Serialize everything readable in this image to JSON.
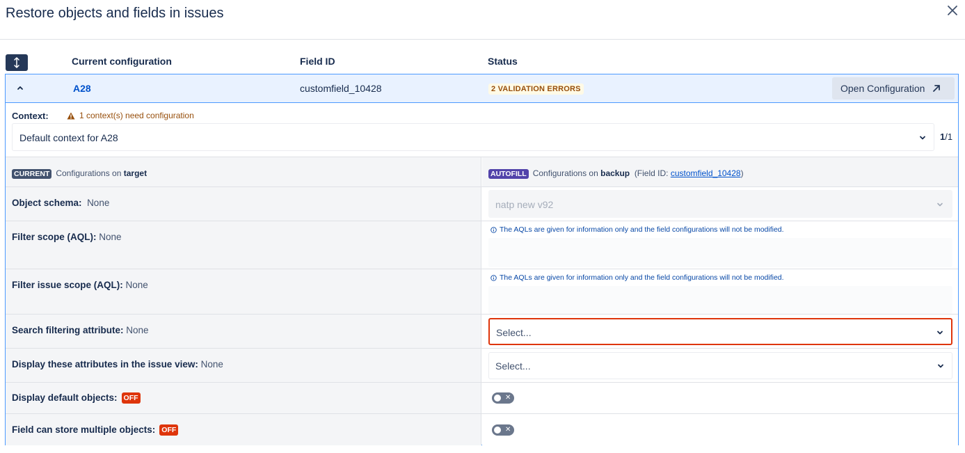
{
  "dialog": {
    "title": "Restore objects and fields in issues"
  },
  "table": {
    "col_current": "Current configuration",
    "col_field_id": "Field ID",
    "col_status": "Status"
  },
  "row": {
    "name": "A28",
    "field_id": "customfield_10428",
    "status": "2 VALIDATION ERRORS",
    "open_config_label": "Open Configuration"
  },
  "context": {
    "label": "Context:",
    "warning": "1 context(s) need configuration",
    "selected": "Default context for A28",
    "pager_current": "1",
    "pager_total": "/1"
  },
  "compare": {
    "current_badge": "CURRENT",
    "current_text": "Configurations on ",
    "current_target": "target",
    "autofill_badge": "AUTOFILL",
    "autofill_text": "Configurations on ",
    "autofill_target": "backup",
    "autofill_field_prefix": "(Field ID: ",
    "autofill_field_link": "customfield_10428",
    "autofill_field_suffix": ")"
  },
  "fields": {
    "object_schema": {
      "label": "Object schema:",
      "value": "None",
      "backup_value": "natp new v92"
    },
    "filter_scope": {
      "label": "Filter scope (AQL):",
      "value": "None",
      "info": "The AQLs are given for information only and the field configurations will not be modified."
    },
    "filter_issue_scope": {
      "label": "Filter issue scope (AQL):",
      "value": "None",
      "info": "The AQLs are given for information only and the field configurations will not be modified."
    },
    "search_filtering": {
      "label": "Search filtering attribute:",
      "value": "None",
      "placeholder": "Select..."
    },
    "display_attributes": {
      "label": "Display these attributes in the issue view:",
      "value": "None",
      "placeholder": "Select..."
    },
    "display_default": {
      "label": "Display default objects:",
      "badge": "OFF"
    },
    "multiple_objects": {
      "label": "Field can store multiple objects:",
      "badge": "OFF"
    }
  },
  "colors": {
    "accent": "#0052cc",
    "error": "#de350b",
    "warning": "#974f0c",
    "panel_border": "#4c9aff"
  },
  "icons": {
    "close": "close-icon",
    "sort": "sort-icon",
    "collapse": "chevron-up-icon",
    "open_external": "arrow-up-right-icon",
    "warning": "warning-icon",
    "info": "info-icon",
    "dropdown": "chevron-down-icon"
  }
}
